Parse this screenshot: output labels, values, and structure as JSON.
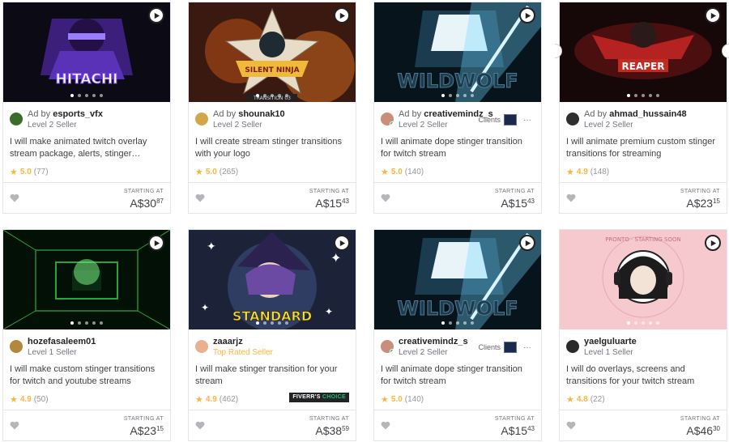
{
  "labels": {
    "starting_at": "STARTING AT",
    "ad_by": "Ad by",
    "clients": "Clients"
  },
  "cards": [
    {
      "art_text": "HITACHI",
      "seller": "esports_vfx",
      "ad": true,
      "level": "Level 2 Seller",
      "title": "I will make animated twitch overlay stream package, alerts, stinger transitions",
      "rating": "5.0",
      "reviews": "(77)",
      "price_main": "A$30",
      "price_cents": "87"
    },
    {
      "art_text": "SILENT NINJA",
      "art_text2": "TRANSITION 03",
      "seller": "shounak10",
      "ad": true,
      "level": "Level 2 Seller",
      "title": "I will create stream stinger transitions with your logo",
      "rating": "5.0",
      "reviews": "(265)",
      "price_main": "A$15",
      "price_cents": "43"
    },
    {
      "art_text": "WILDWOLF",
      "seller": "creativemindz_s",
      "ad": true,
      "level": "Level 2 Seller",
      "clients": true,
      "title": "I will animate dope stinger transition for twitch stream",
      "rating": "5.0",
      "reviews": "(140)",
      "price_main": "A$15",
      "price_cents": "43"
    },
    {
      "art_text": "REAPER",
      "seller": "ahmad_hussain48",
      "ad": true,
      "level": "Level 2 Seller",
      "title": "I will animate premium custom stinger transitions for streaming",
      "rating": "4.9",
      "reviews": "(148)",
      "price_main": "A$23",
      "price_cents": "15"
    },
    {
      "art_text": "",
      "seller": "hozefasaleem01",
      "ad": false,
      "level": "Level 1 Seller",
      "title": "I will make custom stinger transitions for twitch and youtube streams",
      "rating": "4.9",
      "reviews": "(50)",
      "price_main": "A$23",
      "price_cents": "15"
    },
    {
      "art_text": "STANDARD",
      "seller": "zaaarjz",
      "ad": false,
      "level": "Top Rated Seller",
      "top_rated": true,
      "title": "I will make stinger transition for your stream",
      "rating": "4.9",
      "reviews": "(462)",
      "badge_fiverr": "FIVERR'S",
      "badge_choice": "CHOICE",
      "price_main": "A$38",
      "price_cents": "59"
    },
    {
      "art_text": "WILDWOLF",
      "seller": "creativemindz_s",
      "ad": false,
      "level": "Level 2 Seller",
      "clients": true,
      "title": "I will animate dope stinger transition for twitch stream",
      "rating": "5.0",
      "reviews": "(140)",
      "price_main": "A$15",
      "price_cents": "43"
    },
    {
      "art_text": "PRONTO · STARTING SOON",
      "seller": "yaelguluarte",
      "ad": false,
      "level": "Level 1 Seller",
      "title": "I will do overlays, screens and transitions for your twitch stream",
      "rating": "4.8",
      "reviews": "(22)",
      "price_main": "A$46",
      "price_cents": "30"
    }
  ],
  "colors": {
    "star": "#ffb33e",
    "online": "#1dbf73",
    "text": "#404145",
    "muted": "#74767e"
  }
}
